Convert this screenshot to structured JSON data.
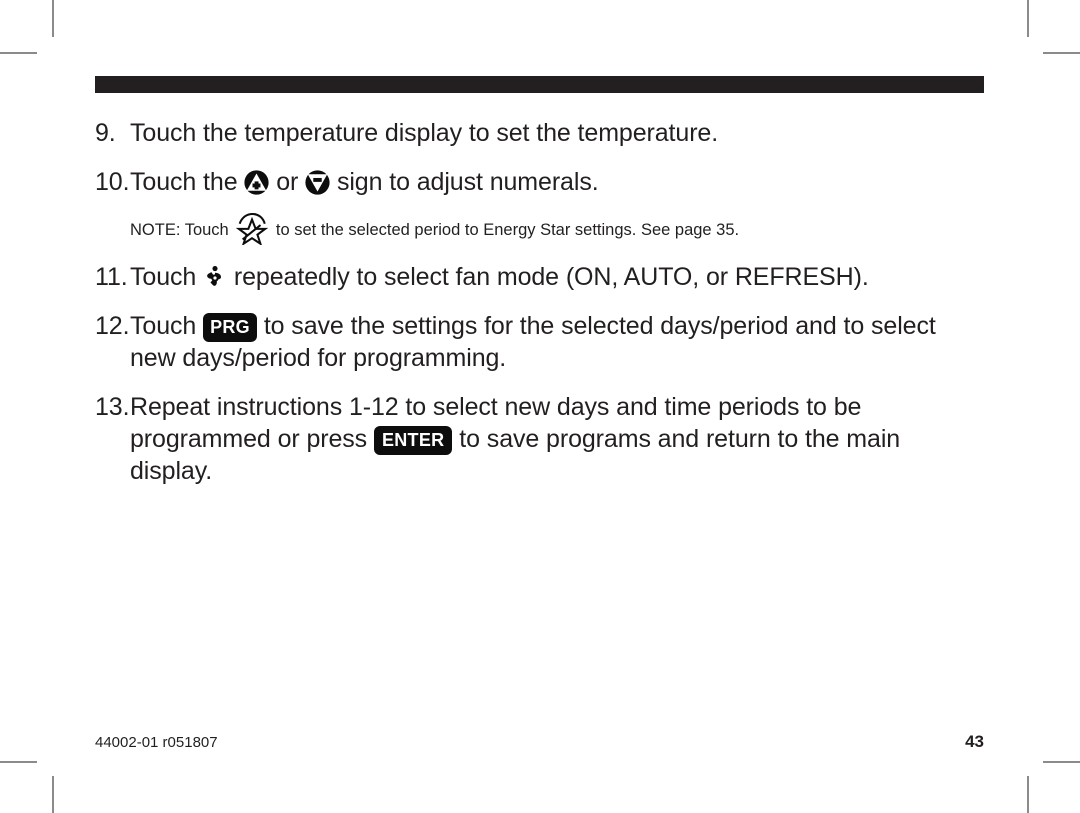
{
  "document": {
    "header_rule_color": "#231f20",
    "body_text_color": "#231f20"
  },
  "steps": [
    {
      "number": "9.",
      "parts": [
        {
          "type": "text",
          "value": "Touch the temperature display to set the temperature."
        }
      ]
    },
    {
      "number": "10.",
      "parts": [
        {
          "type": "text",
          "value": "Touch the "
        },
        {
          "type": "icon",
          "name": "up-arrow-plus-icon"
        },
        {
          "type": "text",
          "value": " or "
        },
        {
          "type": "icon",
          "name": "down-arrow-minus-icon"
        },
        {
          "type": "text",
          "value": " sign to adjust numerals."
        }
      ]
    }
  ],
  "note": {
    "prefix": "NOTE: Touch ",
    "icon": "energy-star-icon",
    "suffix": " to set the selected period to Energy Star settings. See page 35."
  },
  "steps_after_note": [
    {
      "number": "11.",
      "parts": [
        {
          "type": "text",
          "value": "Touch "
        },
        {
          "type": "icon",
          "name": "fan-icon"
        },
        {
          "type": "text",
          "value": " repeatedly to select fan mode (ON, AUTO, or REFRESH)."
        }
      ]
    },
    {
      "number": "12.",
      "parts": [
        {
          "type": "text",
          "value": "Touch "
        },
        {
          "type": "key",
          "label": "PRG"
        },
        {
          "type": "text",
          "value": " to save the settings for the selected days/period and to select new days/period for programming."
        }
      ]
    },
    {
      "number": "13.",
      "parts": [
        {
          "type": "text",
          "value": "Repeat instructions 1-12 to select new days and time periods to be programmed or press "
        },
        {
          "type": "key",
          "label": "ENTER"
        },
        {
          "type": "text",
          "value": " to save programs and return to the main display."
        }
      ]
    }
  ],
  "footer": {
    "document_id": "44002-01 r051807",
    "page_number": "43"
  }
}
